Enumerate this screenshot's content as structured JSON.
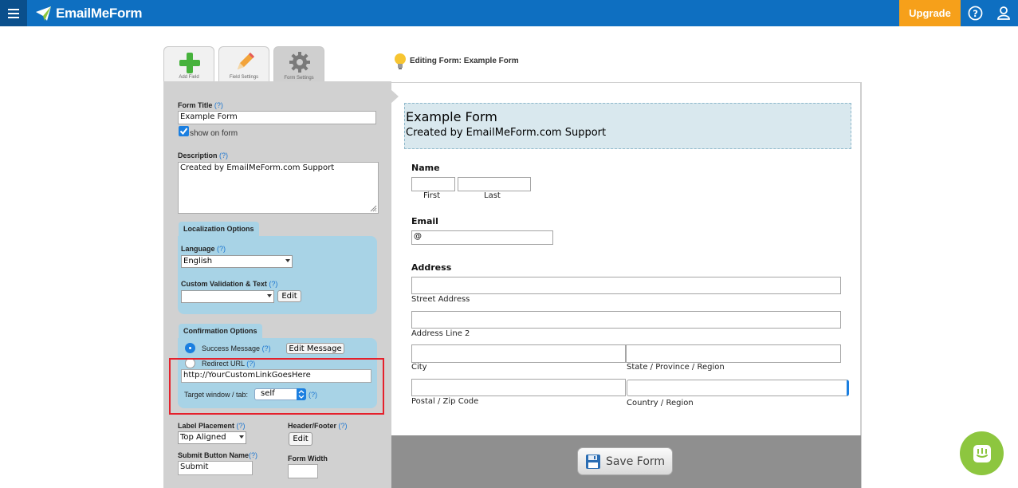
{
  "topbar": {
    "logo_text": "EmailMeForm",
    "upgrade_label": "Upgrade",
    "help_icon": "help-circle-icon",
    "user_icon": "user-icon",
    "brand_color": "#0e6fc1",
    "upgrade_color": "#f6a01a"
  },
  "tabs": [
    {
      "label": "Add Field",
      "icon": "plus-icon"
    },
    {
      "label": "Field Settings",
      "icon": "pencil-icon"
    },
    {
      "label": "Form Settings",
      "icon": "gear-icon"
    }
  ],
  "settings": {
    "form_title_label": "Form Title",
    "help_mark": "(?)",
    "form_title_value": "Example Form",
    "show_on_form_label": "show on form",
    "description_label": "Description",
    "description_value": "Created by EmailMeForm.com Support",
    "localization": {
      "heading": "Localization Options",
      "language_label": "Language",
      "language_value": "English",
      "custom_validation_label": "Custom Validation & Text",
      "edit_label": "Edit"
    },
    "confirmation": {
      "heading": "Confirmation Options",
      "success_label": "Success Message",
      "edit_message_label": "Edit Message",
      "redirect_label": "Redirect URL",
      "redirect_value": "http://YourCustomLinkGoesHere",
      "target_label": "Target window / tab:",
      "target_value": "self"
    },
    "label_placement_label": "Label Placement",
    "label_placement_value": "Top Aligned",
    "header_footer_label": "Header/Footer",
    "header_footer_edit": "Edit",
    "submit_button_label": "Submit Button Name",
    "submit_button_value": "Submit",
    "form_width_label": "Form Width"
  },
  "editing": {
    "title": "Editing Form: Example Form"
  },
  "form": {
    "title": "Example Form",
    "description": "Created by EmailMeForm.com Support",
    "name_label": "Name",
    "first_label": "First",
    "last_label": "Last",
    "email_label": "Email",
    "email_value": "@",
    "address_label": "Address",
    "street_label": "Street Address",
    "line2_label": "Address Line 2",
    "city_label": "City",
    "state_label": "State / Province / Region",
    "postal_label": "Postal / Zip Code",
    "country_label": "Country / Region"
  },
  "save_label": "Save Form"
}
